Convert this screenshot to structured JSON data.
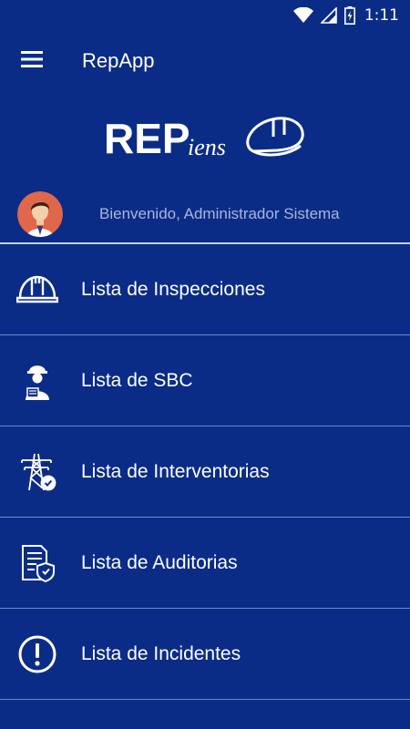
{
  "status_bar": {
    "time": "1:11",
    "icons": [
      "wifi-icon",
      "signal-icon",
      "battery-charging-icon"
    ]
  },
  "app_bar": {
    "title": "RepApp",
    "menu_icon": "hamburger-menu-icon"
  },
  "logo": {
    "text_bold": "REP",
    "text_script": "iens",
    "icon": "hard-hat-icon"
  },
  "welcome": {
    "text": "Bienvenido, Administrador Sistema",
    "avatar": "user-avatar"
  },
  "menu": {
    "items": [
      {
        "label": "Lista de Inspecciones",
        "icon": "hard-hat-icon"
      },
      {
        "label": "Lista de SBC",
        "icon": "worker-icon"
      },
      {
        "label": "Lista de Interventorias",
        "icon": "power-tower-icon"
      },
      {
        "label": "Lista de Auditorias",
        "icon": "audit-document-icon"
      },
      {
        "label": "Lista de Incidentes",
        "icon": "alert-circle-icon"
      }
    ]
  },
  "colors": {
    "background": "#0b2c86",
    "divider": "#6f86c9",
    "welcome_text": "#a9b6da"
  }
}
